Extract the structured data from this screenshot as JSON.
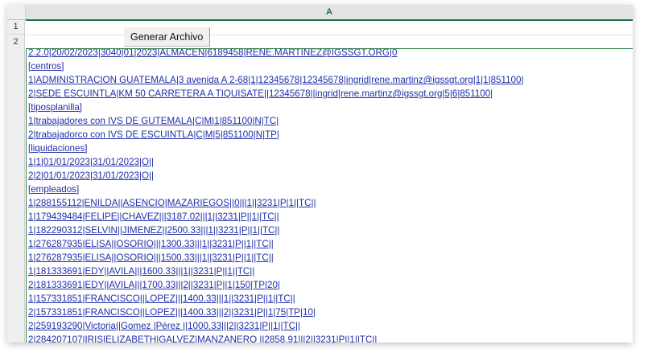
{
  "sheet": {
    "column_label": "A",
    "row_labels": [
      "1",
      "2"
    ]
  },
  "button": {
    "label": "Generar Archivo"
  },
  "content_lines": [
    "2.2.0|20/02/2023|3040|01|2023|ALMACEN|6189458|RENE.MARTINEZ@IGSSGT.ORG|0",
    "[centros]",
    "1|ADMINISTRACION GUATEMALA|3 avenida A 2-68|1|12345678|12345678|ingrid|rene.martinz@igssgt.org|1|1|851100|",
    "2|SEDE ESCUINTLA|KM 50 CARRETERA A TIQUISATE||12345678||ingrid|rene.martinz@igssgt.org|5|6|851100|",
    "[tiposplanilla]",
    "1|trabajadores con IVS DE GUTEMALA|C|M|1|851100|N|TC|",
    "2|trabajadorco con IVS DE ESCUINTLA|C|M|5|851100|N|TP|",
    "[liquidaciones]",
    "1|1|01/01/2023|31/01/2023|O||",
    "2|2|01/01/2023|31/01/2023|O||",
    "[empleados]",
    "1|288155112|ENILDA||ASENCIO|MAZARIEGOS||0|||1||3231|P|1||TC||",
    "1|179439484|FELIPE||CHAVEZ|||3187.02|||1||3231|P||1||TC||",
    "1|182290312|SELVIN||JIMENEZ||2500.33|||1||3231|P||1||TC||",
    "1|276287935|ELISA||OSORIO|||1300.33|||1||3231|P||1||TC||",
    "1|276287935|ELISA||OSORIO|||1500.33|||1||3231|P||1||TC||",
    "1|181333691|EDY||AVILA|||1600.33|||1||3231|P||1||TC||",
    "2|181333691|EDY||AVILA|||1700.33|||2||3231|P||1|150|TP|20|",
    "1|157331851|FRANCISCO||LOPEZ|||1400.33|||1||3231|P||1||TC||",
    "2|157331851|FRANCISCO||LOPEZ|||1400.33|||2||3231|P||1|75|TP|10|",
    "2|259193290|Victoria||Gomez |Pérez ||1000.33|||2||3231|P||1||TC||",
    "2|284207107|IRIS|ELIZABETH|GALVEZ|MANZANERO ||2858.91|||2||3231|P||1||TC||"
  ]
}
